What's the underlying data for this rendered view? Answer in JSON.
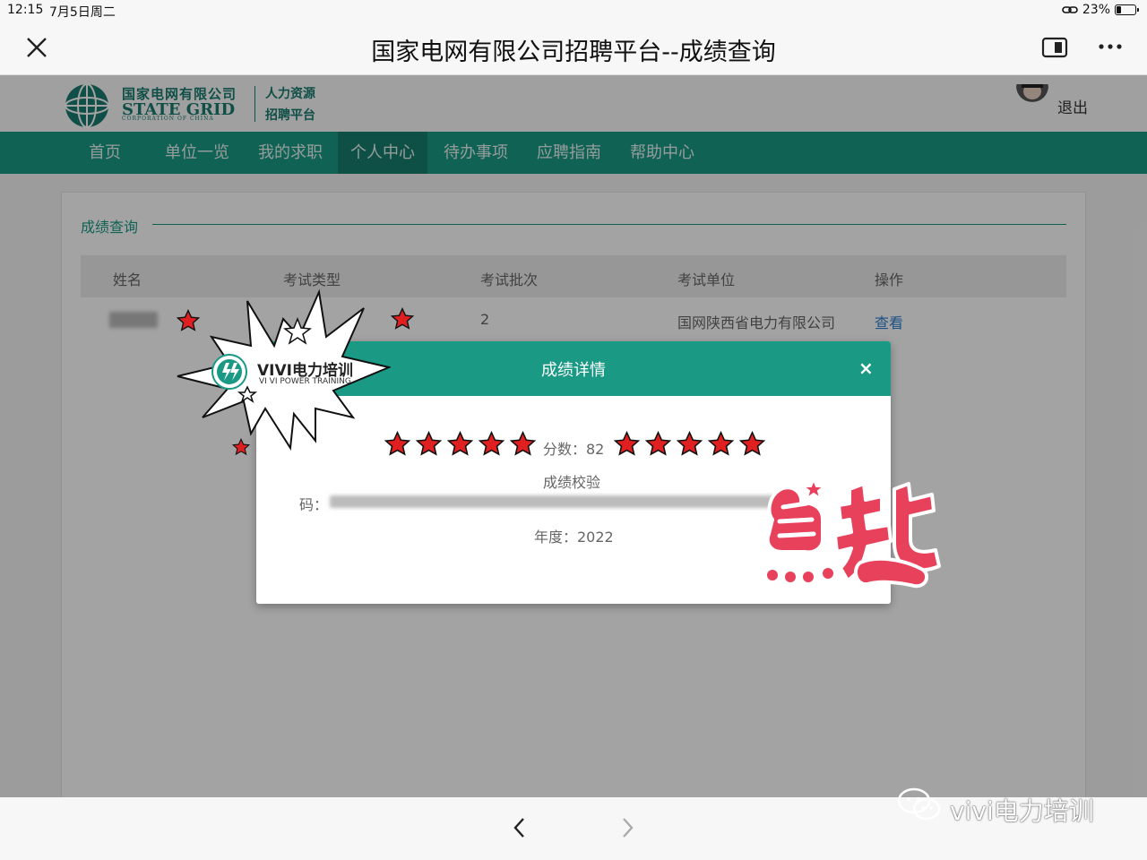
{
  "status_bar": {
    "time": "12:15",
    "date": "7月5日周二",
    "battery": "23%",
    "battery_level": 0.23
  },
  "browser": {
    "title": "国家电网有限公司招聘平台--成绩查询",
    "close_icon": "close-icon",
    "split_icon": "split-view-icon",
    "more_icon": "more-icon"
  },
  "site_header": {
    "logo_cn": "国家电网有限公司",
    "logo_en": "STATE GRID",
    "logo_sub": "CORPORATION OF CHINA",
    "logo_hr1": "人力资源",
    "logo_hr2": "招聘平台",
    "logout": "退出"
  },
  "nav": {
    "items": [
      "首页",
      "单位一览",
      "我的求职",
      "个人中心",
      "待办事项",
      "应聘指南",
      "帮助中心"
    ],
    "active": "个人中心"
  },
  "section": {
    "title": "成绩查询"
  },
  "table": {
    "headers": [
      "姓名",
      "考试类型",
      "考试批次",
      "考试单位",
      "操作"
    ],
    "row": {
      "batch": "2",
      "unit": "国网陕西省电力有限公司",
      "action": "查看"
    }
  },
  "modal": {
    "title": "成绩详情",
    "close": "×",
    "score": "分数：82",
    "verify": "成绩校验",
    "code_label": "码：",
    "year": "年度：2022"
  },
  "sticker": {
    "brand": "VIVI电力培训",
    "brand_en": "VI VI POWER TRAINING",
    "thumbs_text": "点赞"
  },
  "watermark": {
    "text": "vivi电力培训"
  },
  "colors": {
    "primary": "#1a9985",
    "star_red": "#e02020",
    "link": "#2f7fd0"
  }
}
